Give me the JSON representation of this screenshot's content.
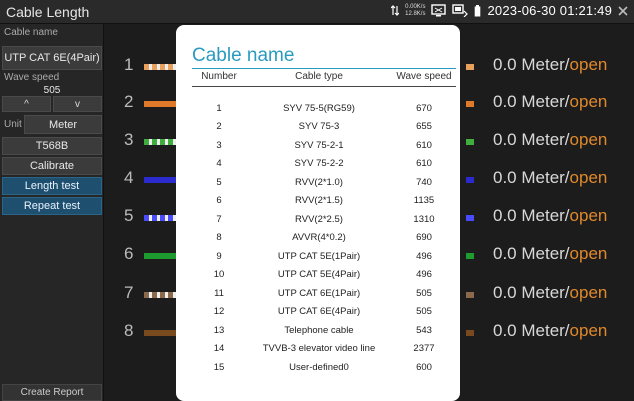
{
  "app": {
    "title": "Cable Length"
  },
  "status": {
    "net_up": "0.00K/s",
    "net_down": "12.8K/s",
    "datetime": "2023-06-30 01:21:49"
  },
  "sidebar": {
    "cable_name_label": "Cable name",
    "cable_name_value": "UTP CAT 6E(4Pair)",
    "wave_speed_label": "Wave speed",
    "wave_speed_value": "505",
    "up_arrow": "^",
    "down_arrow": "v",
    "unit_label": "Unit",
    "unit_value": "Meter",
    "standard": "T568B",
    "calibrate": "Calibrate",
    "length_test": "Length test",
    "repeat_test": "Repeat test",
    "create_report": "Create Report"
  },
  "pairs": [
    {
      "num": "1",
      "value": "0.0 Meter/",
      "state": "open"
    },
    {
      "num": "2",
      "value": "0.0 Meter/",
      "state": "open"
    },
    {
      "num": "3",
      "value": "0.0 Meter/",
      "state": "open"
    },
    {
      "num": "4",
      "value": "0.0 Meter/",
      "state": "open"
    },
    {
      "num": "5",
      "value": "0.0 Meter/",
      "state": "open"
    },
    {
      "num": "6",
      "value": "0.0 Meter/",
      "state": "open"
    },
    {
      "num": "7",
      "value": "0.0 Meter/",
      "state": "open"
    },
    {
      "num": "8",
      "value": "0.0 Meter/",
      "state": "open"
    }
  ],
  "wire_colors": {
    "pair1": "#e8a05c",
    "pair2": "#e07a2a",
    "pair3": "#3fae3f",
    "pair4": "#2a2acf",
    "pair5": "#4a4aff",
    "pair6": "#1f9a2f",
    "pair7": "#8a6a4a",
    "pair8": "#7a4a1f"
  },
  "modal": {
    "title": "Cable name",
    "headers": {
      "number": "Number",
      "type": "Cable type",
      "speed": "Wave speed"
    },
    "rows": [
      {
        "n": "1",
        "type": "SYV 75-5(RG59)",
        "speed": "670"
      },
      {
        "n": "2",
        "type": "SYV 75-3",
        "speed": "655"
      },
      {
        "n": "3",
        "type": "SYV 75-2-1",
        "speed": "610"
      },
      {
        "n": "4",
        "type": "SYV 75-2-2",
        "speed": "610"
      },
      {
        "n": "5",
        "type": "RVV(2*1.0)",
        "speed": "740"
      },
      {
        "n": "6",
        "type": "RVV(2*1.5)",
        "speed": "1135"
      },
      {
        "n": "7",
        "type": "RVV(2*2.5)",
        "speed": "1310"
      },
      {
        "n": "8",
        "type": "AVVR(4*0.2)",
        "speed": "690"
      },
      {
        "n": "9",
        "type": "UTP CAT 5E(1Pair)",
        "speed": "496"
      },
      {
        "n": "10",
        "type": "UTP CAT 5E(4Pair)",
        "speed": "496"
      },
      {
        "n": "11",
        "type": "UTP CAT 6E(1Pair)",
        "speed": "505"
      },
      {
        "n": "12",
        "type": "UTP CAT 6E(4Pair)",
        "speed": "505"
      },
      {
        "n": "13",
        "type": "Telephone cable",
        "speed": "543"
      },
      {
        "n": "14",
        "type": "TVVB-3 elevator video line",
        "speed": "2377"
      },
      {
        "n": "15",
        "type": "User-defined0",
        "speed": "600"
      }
    ]
  }
}
